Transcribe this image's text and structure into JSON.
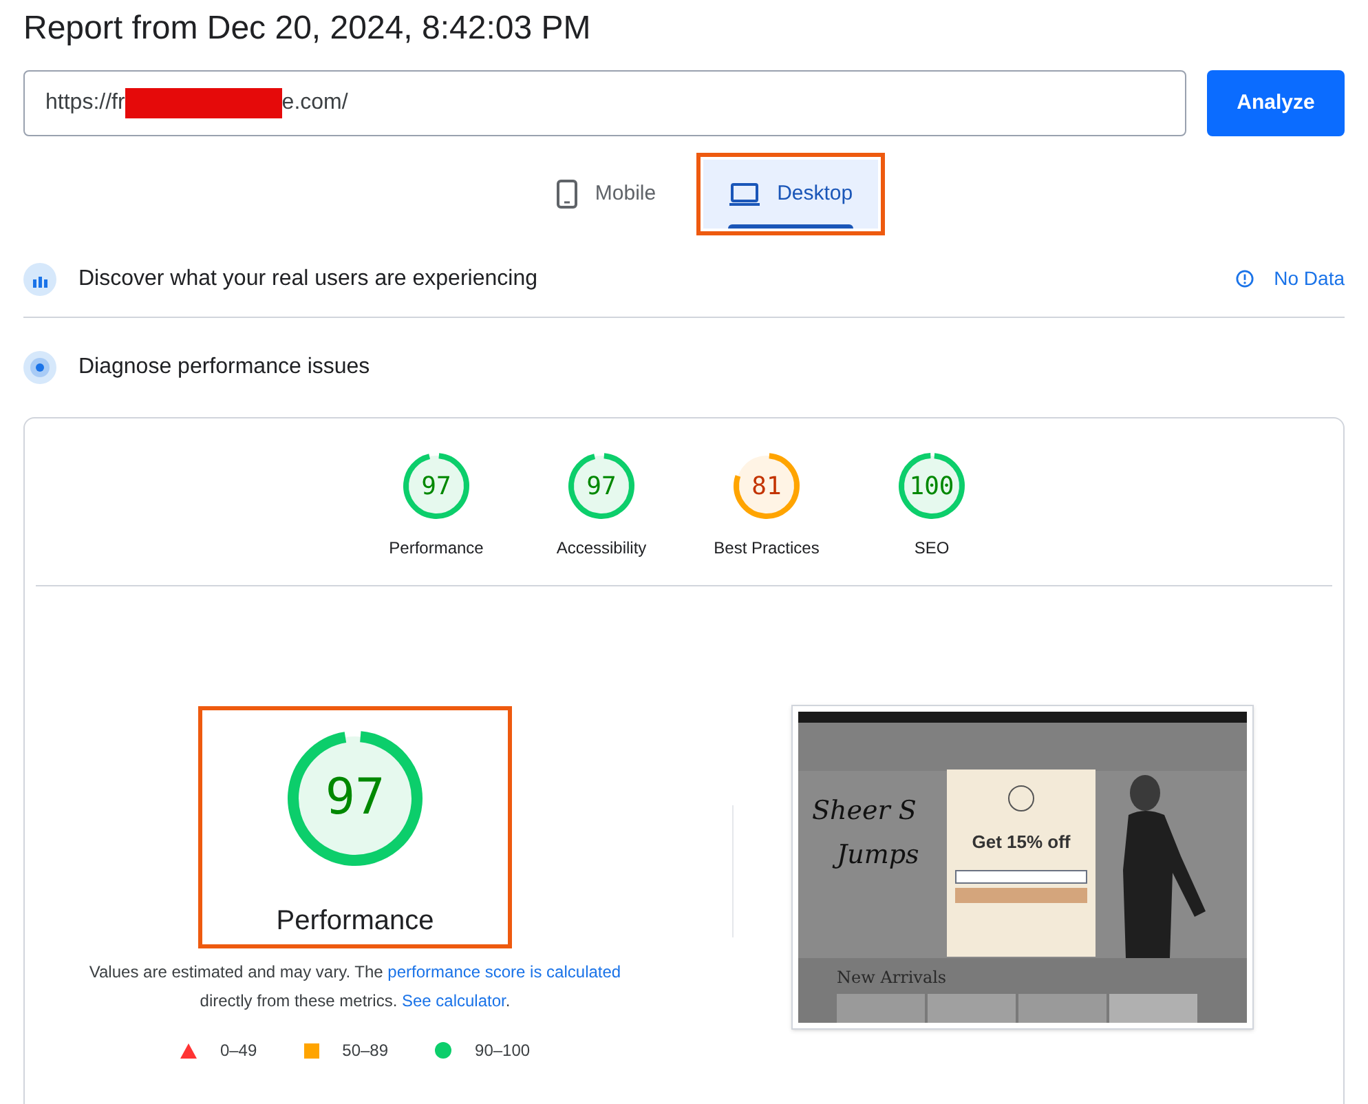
{
  "title": "Report from Dec 20, 2024, 8:42:03 PM",
  "url_field": {
    "value_start": "https://fr",
    "redacted": true,
    "value_end": "e.com/"
  },
  "analyze_button": "Analyze",
  "tabs": [
    {
      "label": "Mobile",
      "kind": "phone",
      "selected": false,
      "highlighted": false
    },
    {
      "label": "Desktop",
      "kind": "laptop",
      "selected": true,
      "highlighted": true
    }
  ],
  "real_users": {
    "label": "Discover what your real users are experiencing",
    "status": "No Data"
  },
  "diagnose": {
    "label": "Diagnose performance issues"
  },
  "scores": [
    {
      "value": "97",
      "label": "Performance",
      "color": "#0cce6b"
    },
    {
      "value": "97",
      "label": "Accessibility",
      "color": "#0cce6b"
    },
    {
      "value": "81",
      "label": "Best Practices",
      "color": "#ffa400"
    },
    {
      "value": "100",
      "label": "SEO",
      "color": "#0cce6b"
    }
  ],
  "main_score": {
    "value": "97",
    "label": "Performance",
    "color": "#0cce6b",
    "highlighted": true
  },
  "note": {
    "text": "Values are estimated and may vary. The ",
    "link": "performance score is calculated",
    "text2": "directly from these metrics. ",
    "link2": "See calculator",
    "text3": "."
  },
  "legend": [
    {
      "kind": "triangle",
      "label": "0–49",
      "color": "#ff3333"
    },
    {
      "kind": "square",
      "label": "50–89",
      "color": "#ffa400"
    },
    {
      "kind": "circle",
      "label": "90–100",
      "color": "#0cce6b"
    }
  ],
  "thumbnail": {
    "hero_line1": "Sheer S",
    "hero_line2": "Jumps",
    "popup_title": "Get 15% off",
    "section": "New Arrivals"
  }
}
